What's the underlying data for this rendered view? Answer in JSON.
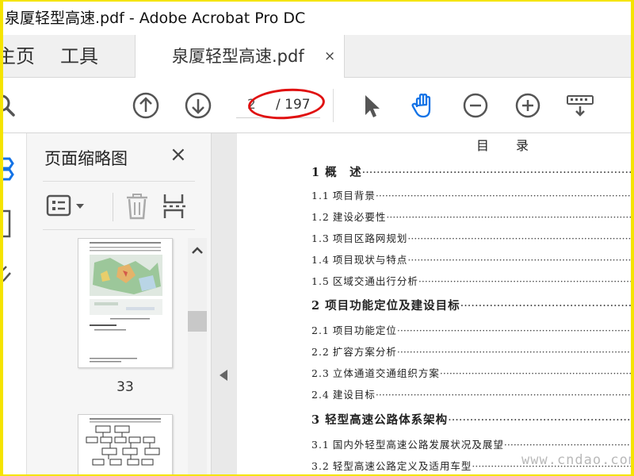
{
  "window": {
    "title": "泉厦轻型高速.pdf - Adobe Acrobat Pro DC"
  },
  "tabs": {
    "home": "主页",
    "tools": "工具",
    "document": "泉厦轻型高速.pdf",
    "close": "×"
  },
  "toolbar": {
    "page_current": "2",
    "page_total": "/ 197",
    "icons": [
      "search-icon",
      "prev-page-icon",
      "next-page-icon",
      "select-arrow-icon",
      "hand-tool-icon",
      "zoom-out-icon",
      "zoom-in-icon",
      "keyboard-icon"
    ],
    "accent_color": "#1473e6",
    "annotation_color": "#e01010"
  },
  "thumbnails_panel": {
    "title": "页面缩略图",
    "close": "×",
    "page_number_label": "33"
  },
  "document": {
    "toc_heading": "目录",
    "toc": [
      {
        "num": "1",
        "text": "概　述",
        "level": 1
      },
      {
        "num": "1.1",
        "text": "项目背景",
        "level": 2
      },
      {
        "num": "1.2",
        "text": "建设必要性",
        "level": 2
      },
      {
        "num": "1.3",
        "text": "项目区路网规划",
        "level": 2
      },
      {
        "num": "1.4",
        "text": "项目现状与特点",
        "level": 2
      },
      {
        "num": "1.5",
        "text": "区域交通出行分析",
        "level": 2
      },
      {
        "num": "2",
        "text": "项目功能定位及建设目标",
        "level": 1
      },
      {
        "num": "2.1",
        "text": "项目功能定位",
        "level": 2
      },
      {
        "num": "2.2",
        "text": "扩容方案分析",
        "level": 2
      },
      {
        "num": "2.3",
        "text": "立体通道交通组织方案",
        "level": 2
      },
      {
        "num": "2.4",
        "text": "建设目标",
        "level": 2
      },
      {
        "num": "3",
        "text": "轻型高速公路体系架构",
        "level": 1
      },
      {
        "num": "3.1",
        "text": "国内外轻型高速公路发展状况及展望",
        "level": 2
      },
      {
        "num": "3.2",
        "text": "轻型高速公路定义及适用车型",
        "level": 2
      }
    ],
    "dots": "··········································································································"
  },
  "watermark": "www.cndao.com",
  "colors": {
    "border": "#f5e400",
    "panel_bg": "#f6f6f6",
    "doc_bg": "#e9e9e9"
  }
}
